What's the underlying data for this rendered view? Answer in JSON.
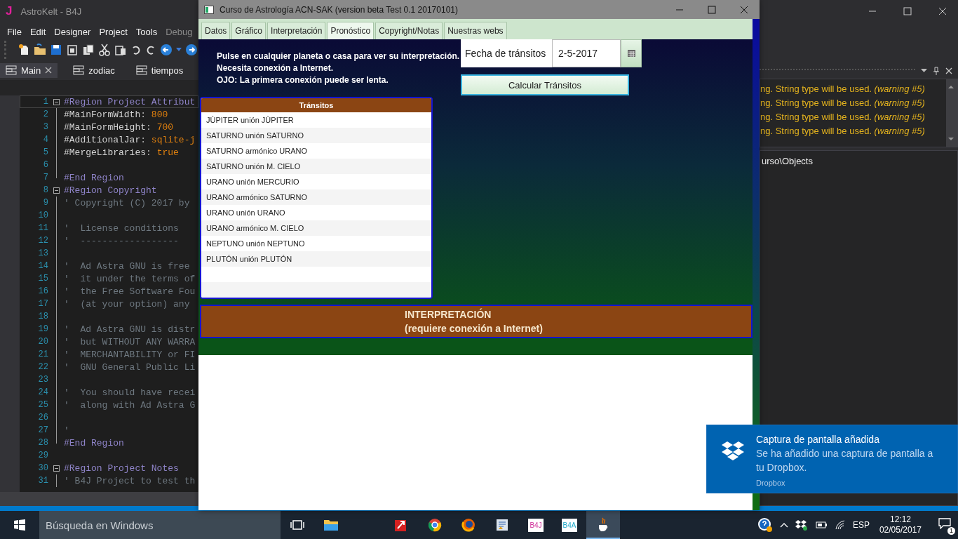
{
  "ide": {
    "logo": "J",
    "title": "AstroKelt - B4J",
    "menu": [
      {
        "label": "File",
        "disabled": false
      },
      {
        "label": "Edit",
        "disabled": false
      },
      {
        "label": "Designer",
        "disabled": false
      },
      {
        "label": "Project",
        "disabled": false
      },
      {
        "label": "Tools",
        "disabled": false
      },
      {
        "label": "Debug",
        "disabled": true
      }
    ],
    "tabs": [
      {
        "label": "Main",
        "selected": true
      },
      {
        "label": "zodiac",
        "selected": false
      },
      {
        "label": "tiempos",
        "selected": false
      }
    ],
    "code_lines": [
      {
        "number": "1",
        "kind": "fold-start",
        "current": true,
        "parts": [
          {
            "text": "#Region Project Attribut",
            "kind": "directive"
          }
        ]
      },
      {
        "number": "2",
        "kind": "fold-inside",
        "current": false,
        "parts": [
          {
            "text": "#MainFormWidth",
            "kind": "attr"
          },
          {
            "text": ": ",
            "kind": "punct"
          },
          {
            "text": "800",
            "kind": "value"
          }
        ]
      },
      {
        "number": "3",
        "kind": "fold-inside",
        "current": false,
        "parts": [
          {
            "text": "#MainFormHeight",
            "kind": "attr"
          },
          {
            "text": ": ",
            "kind": "punct"
          },
          {
            "text": "700",
            "kind": "value"
          }
        ]
      },
      {
        "number": "4",
        "kind": "fold-inside",
        "current": false,
        "parts": [
          {
            "text": "#AdditionalJar",
            "kind": "attr"
          },
          {
            "text": ": ",
            "kind": "punct"
          },
          {
            "text": "sqlite-j",
            "kind": "value"
          }
        ]
      },
      {
        "number": "5",
        "kind": "fold-inside",
        "current": false,
        "parts": [
          {
            "text": "#MergeLibraries",
            "kind": "attr"
          },
          {
            "text": ": ",
            "kind": "punct"
          },
          {
            "text": "true",
            "kind": "value"
          }
        ]
      },
      {
        "number": "6",
        "kind": "fold-inside",
        "current": false
      },
      {
        "number": "7",
        "kind": "fold-end",
        "current": false,
        "parts": [
          {
            "text": "#End Region",
            "kind": "directive"
          }
        ]
      },
      {
        "number": "8",
        "kind": "fold-start",
        "current": false,
        "parts": [
          {
            "text": "#Region Copyright",
            "kind": "directive"
          }
        ]
      },
      {
        "number": "9",
        "kind": "fold-inside",
        "current": false,
        "parts": [
          {
            "text": "' Copyright (C) 2017 by",
            "kind": "comment"
          }
        ]
      },
      {
        "number": "10",
        "kind": "fold-inside",
        "current": false
      },
      {
        "number": "11",
        "kind": "fold-inside",
        "current": false,
        "parts": [
          {
            "text": "'  License conditions",
            "kind": "comment"
          }
        ]
      },
      {
        "number": "12",
        "kind": "fold-inside",
        "current": false,
        "parts": [
          {
            "text": "'  ------------------",
            "kind": "comment"
          }
        ]
      },
      {
        "number": "13",
        "kind": "fold-inside",
        "current": false
      },
      {
        "number": "14",
        "kind": "fold-inside",
        "current": false,
        "parts": [
          {
            "text": "'  Ad Astra GNU is free",
            "kind": "comment"
          }
        ]
      },
      {
        "number": "15",
        "kind": "fold-inside",
        "current": false,
        "parts": [
          {
            "text": "'  it under the terms of",
            "kind": "comment"
          }
        ]
      },
      {
        "number": "16",
        "kind": "fold-inside",
        "current": false,
        "parts": [
          {
            "text": "'  the Free Software Fou",
            "kind": "comment"
          }
        ]
      },
      {
        "number": "17",
        "kind": "fold-inside",
        "current": false,
        "parts": [
          {
            "text": "'  (at your option) any",
            "kind": "comment"
          }
        ]
      },
      {
        "number": "18",
        "kind": "fold-inside",
        "current": false
      },
      {
        "number": "19",
        "kind": "fold-inside",
        "current": false,
        "parts": [
          {
            "text": "'  Ad Astra GNU is distr",
            "kind": "comment"
          }
        ]
      },
      {
        "number": "20",
        "kind": "fold-inside",
        "current": false,
        "parts": [
          {
            "text": "'  but WITHOUT ANY WARRA",
            "kind": "comment"
          }
        ]
      },
      {
        "number": "21",
        "kind": "fold-inside",
        "current": false,
        "parts": [
          {
            "text": "'  MERCHANTABILITY or FI",
            "kind": "comment"
          }
        ]
      },
      {
        "number": "22",
        "kind": "fold-inside",
        "current": false,
        "parts": [
          {
            "text": "'  GNU General Public Li",
            "kind": "comment"
          }
        ]
      },
      {
        "number": "23",
        "kind": "fold-inside",
        "current": false
      },
      {
        "number": "24",
        "kind": "fold-inside",
        "current": false,
        "parts": [
          {
            "text": "'  You should have recei",
            "kind": "comment"
          }
        ]
      },
      {
        "number": "25",
        "kind": "fold-inside",
        "current": false,
        "parts": [
          {
            "text": "'  along with Ad Astra G",
            "kind": "comment"
          }
        ]
      },
      {
        "number": "26",
        "kind": "fold-inside",
        "current": false
      },
      {
        "number": "27",
        "kind": "fold-inside",
        "current": false,
        "parts": [
          {
            "text": "'",
            "kind": "comment"
          }
        ]
      },
      {
        "number": "28",
        "kind": "fold-end",
        "current": false,
        "parts": [
          {
            "text": "#End Region",
            "kind": "directive"
          }
        ]
      },
      {
        "number": "29",
        "kind": "plain",
        "current": false
      },
      {
        "number": "30",
        "kind": "fold-start",
        "current": false,
        "parts": [
          {
            "text": "#Region Project Notes",
            "kind": "directive"
          }
        ]
      },
      {
        "number": "31",
        "kind": "fold-inside",
        "current": false,
        "parts": [
          {
            "text": "' B4J Project to test th",
            "kind": "comment"
          }
        ]
      }
    ],
    "warnings": [
      "ng. String type will be used. *(warning #5)*",
      "ng. String type will be used. *(warning #5)*",
      "ng. String type will be used. *(warning #5)*",
      "ng. String type will be used. *(warning #5)*"
    ],
    "path": "urso\\Objects"
  },
  "app": {
    "title": "Curso de Astrología ACN-SAK (version beta Test 0.1 20170101)",
    "tabs": [
      {
        "label": "Datos",
        "selected": false
      },
      {
        "label": "Gráfico",
        "selected": false
      },
      {
        "label": "Interpretación",
        "selected": false
      },
      {
        "label": "Pronóstico",
        "selected": true
      },
      {
        "label": "Copyright/Notas",
        "selected": false
      },
      {
        "label": "Nuestras webs",
        "selected": false
      }
    ],
    "instructions": [
      "Pulse en cualquier planeta o casa para ver su interpretación.",
      "Necesita conexión a Internet.",
      "OJO: La primera conexión puede ser lenta."
    ],
    "date_label": "Fecha de tránsitos",
    "date_value": "2-5-2017",
    "calc_button": "Calcular Tránsitos",
    "transits": {
      "header": "Tránsitos",
      "rows": [
        "JÙPITER unión JÙPITER",
        "SATURNO unión SATURNO",
        "SATURNO armónico URANO",
        "SATURNO unión M. CIELO",
        "URANO unión MERCURIO",
        "URANO armónico SATURNO",
        "URANO unión URANO",
        "URANO armónico M. CIELO",
        "NEPTUNO unión NEPTUNO",
        "PLUTÓN unión PLUTÓN"
      ]
    },
    "interpretation": {
      "title": "INTERPRETACIÓN",
      "subtitle": "(requiere conexión a Internet)"
    }
  },
  "notification": {
    "title": "Captura de pantalla añadida",
    "message": "Se ha añadido una captura de pantalla a tu Dropbox.",
    "source": "Dropbox"
  },
  "taskbar": {
    "search_placeholder": "Búsqueda en Windows",
    "apps": [
      {
        "kind": "taskview",
        "selected": false
      },
      {
        "kind": "explorer",
        "selected": false
      },
      {
        "kind": "redapp",
        "selected": false
      },
      {
        "kind": "chrome",
        "selected": false
      },
      {
        "kind": "firefox",
        "selected": false
      },
      {
        "kind": "document",
        "selected": false
      },
      {
        "kind": "b4j",
        "label": "B4J",
        "selected": false
      },
      {
        "kind": "b4a",
        "label": "B4A",
        "selected": false
      },
      {
        "kind": "java",
        "selected": true
      }
    ],
    "language": "ESP",
    "time": "12:12",
    "date": "02/05/2017",
    "notification_count": "1"
  }
}
